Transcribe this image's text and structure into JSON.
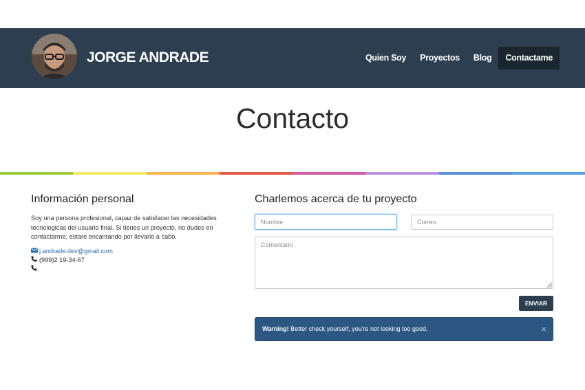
{
  "header": {
    "brand": "JORGE ANDRADE",
    "nav": [
      "Quien Soy",
      "Proyectos",
      "Blog",
      "Contactame"
    ],
    "active_nav": "Contactame"
  },
  "page": {
    "title": "Contacto"
  },
  "rainbow_colors": [
    "#9ccc3d",
    "#f5e96a",
    "#f8b44c",
    "#e65a49",
    "#d45aa7",
    "#ba8ee0",
    "#5b8fd9",
    "#5aa2e0"
  ],
  "info": {
    "heading": "Información personal",
    "paragraph": "Soy una persona profesional, capaz de satisfacer las necesidades tecnologicas del usuario final. Si tienes un proyecto, no dudes en contactarme, estare encantando por llevarlo a cabo.",
    "email": "j.andrade.dev@gmail.com",
    "phone": "(999)2 19-34-67",
    "phone2": ""
  },
  "form": {
    "heading": "Charlemos acerca de tu proyecto",
    "name_placeholder": "Nombre",
    "email_placeholder": "Correo",
    "comment_placeholder": "Comentario",
    "submit_label": "ENVIAR"
  },
  "alert": {
    "strong": "Warning!",
    "message": " Better check yourself, you're not looking too good.",
    "close": "×"
  },
  "icons": {
    "email": "envelope-icon",
    "phone": "phone-icon"
  }
}
